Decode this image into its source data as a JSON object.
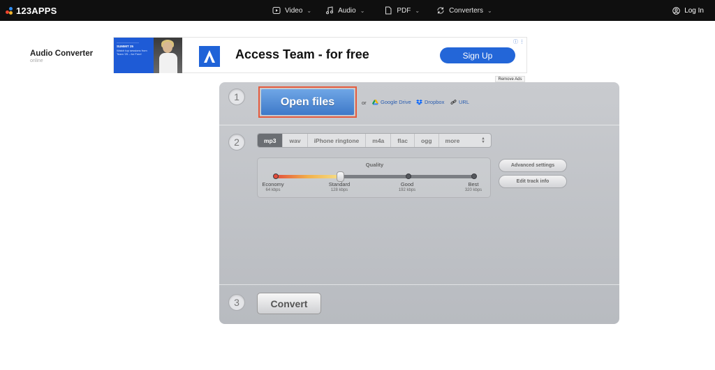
{
  "topbar": {
    "logo_text": "123APPS",
    "nav": [
      {
        "label": "Video",
        "icon": "video-icon"
      },
      {
        "label": "Audio",
        "icon": "music-note-icon"
      },
      {
        "label": "PDF",
        "icon": "document-icon"
      },
      {
        "label": "Converters",
        "icon": "convert-icon"
      }
    ],
    "login_label": "Log In"
  },
  "app": {
    "title": "Audio Converter",
    "subtitle": "online"
  },
  "ad": {
    "thumb_line1": "————————",
    "thumb_line2": "SUMMIT 25",
    "thumb_line3": "Watch top sessions from Team '25 – for Free!",
    "headline": "Access Team - for free",
    "button": "Sign Up",
    "info": "ⓘ ⋮",
    "remove_ads": "Remove Ads"
  },
  "step1": {
    "number": "1",
    "open_files": "Open files",
    "or": "or",
    "sources": [
      {
        "label": "Google Drive",
        "icon": "google-drive-icon"
      },
      {
        "label": "Dropbox",
        "icon": "dropbox-icon"
      },
      {
        "label": "URL",
        "icon": "link-icon"
      }
    ]
  },
  "step2": {
    "number": "2",
    "formats": [
      "mp3",
      "wav",
      "iPhone ringtone",
      "m4a",
      "flac",
      "ogg"
    ],
    "selected_format": "mp3",
    "more_label": "more",
    "more_arrow": "⌃⌄",
    "quality": {
      "label": "Quality",
      "selected_index": 1,
      "levels": [
        {
          "name": "Economy",
          "kbps": "64 kbps"
        },
        {
          "name": "Standard",
          "kbps": "128 kbps"
        },
        {
          "name": "Good",
          "kbps": "192 kbps"
        },
        {
          "name": "Best",
          "kbps": "320 kbps"
        }
      ]
    },
    "advanced_settings": "Advanced settings",
    "edit_track_info": "Edit track info"
  },
  "step3": {
    "number": "3",
    "convert": "Convert"
  },
  "colors": {
    "accent": "#2366d8",
    "open_files_border": "#e55a3c",
    "topbar": "#0f0f0f"
  }
}
